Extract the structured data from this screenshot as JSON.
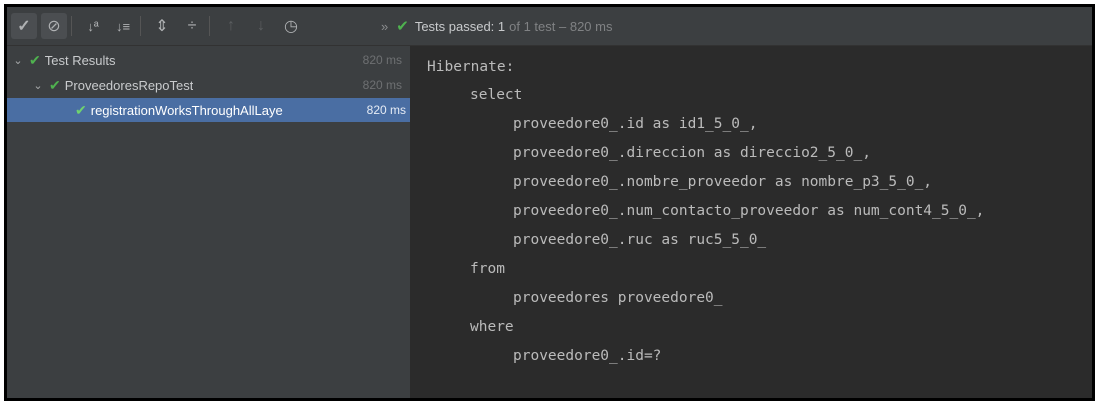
{
  "toolbar": {
    "buttons": [
      {
        "icon": "show-passed-icon",
        "glyph": "✓"
      },
      {
        "icon": "show-ignored-icon",
        "glyph": "⊘"
      },
      {
        "icon": "sort-alphabetically-icon",
        "glyph": "↓ª"
      },
      {
        "icon": "sort-by-duration-icon",
        "glyph": "↓≡"
      },
      {
        "icon": "expand-all-icon",
        "glyph": "⇕"
      },
      {
        "icon": "collapse-all-icon",
        "glyph": "÷"
      },
      {
        "icon": "previous-failed-icon",
        "glyph": "↑"
      },
      {
        "icon": "next-failed-icon",
        "glyph": "↓"
      },
      {
        "icon": "test-history-icon",
        "glyph": "◷"
      }
    ]
  },
  "status": {
    "chevron": "»",
    "passed_label": "Tests passed: 1",
    "detail": "of 1 test – 820 ms"
  },
  "tree": [
    {
      "label": "Test Results",
      "time": "820 ms",
      "level": 0,
      "expanded": true,
      "selected": false
    },
    {
      "label": "ProveedoresRepoTest",
      "time": "820 ms",
      "level": 1,
      "expanded": true,
      "selected": false
    },
    {
      "label": "registrationWorksThroughAllLaye",
      "time": "820 ms",
      "level": 2,
      "expanded": false,
      "selected": true
    }
  ],
  "console": [
    {
      "text": "Hibernate:",
      "indent": 0
    },
    {
      "text": "select",
      "indent": 1
    },
    {
      "text": "proveedore0_.id as id1_5_0_,",
      "indent": 2
    },
    {
      "text": "proveedore0_.direccion as direccio2_5_0_,",
      "indent": 2
    },
    {
      "text": "proveedore0_.nombre_proveedor as nombre_p3_5_0_,",
      "indent": 2
    },
    {
      "text": "proveedore0_.num_contacto_proveedor as num_cont4_5_0_,",
      "indent": 2
    },
    {
      "text": "proveedore0_.ruc as ruc5_5_0_",
      "indent": 2
    },
    {
      "text": "from",
      "indent": 1
    },
    {
      "text": "proveedores proveedore0_",
      "indent": 2
    },
    {
      "text": "where",
      "indent": 1
    },
    {
      "text": "proveedore0_.id=?",
      "indent": 2
    }
  ],
  "colors": {
    "pass": "#4fb24f",
    "selection": "#4a6ea3",
    "panel": "#3c3f41",
    "console_bg": "#2b2b2b"
  }
}
